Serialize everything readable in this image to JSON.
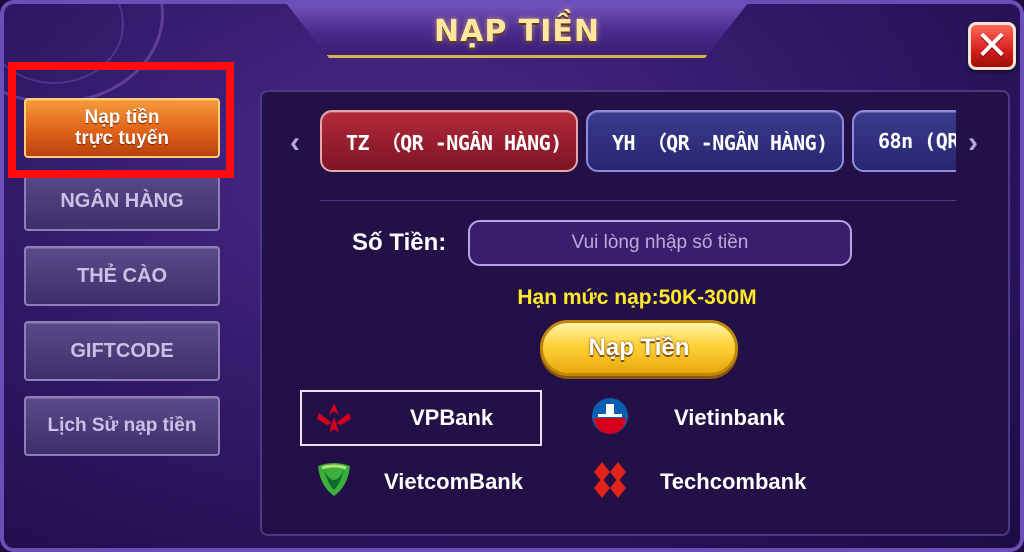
{
  "title": "NẠP TIỀN",
  "close_label": "✕",
  "sidebar": {
    "items": [
      {
        "label_line1": "Nạp tiền",
        "label_line2": "trực tuyến",
        "active": true
      },
      {
        "label": "NGÂN HÀNG"
      },
      {
        "label": "THẺ CÀO"
      },
      {
        "label": "GIFTCODE"
      },
      {
        "label": "Lịch Sử nạp tiền"
      }
    ]
  },
  "tabs": [
    {
      "label": "TZ （QR -NGÂN HÀNG)",
      "active": true
    },
    {
      "label": "YH （QR -NGÂN HÀNG)",
      "active": false
    },
    {
      "label": "68n (QR",
      "active": false
    }
  ],
  "arrows": {
    "left": "‹",
    "right": "›"
  },
  "form": {
    "amount_label": "Số Tiền:",
    "amount_placeholder": "Vui lòng nhập số tiền",
    "amount_value": "",
    "limit_text": "Hạn mức nạp:50K-300M",
    "submit_label": "Nạp Tiền"
  },
  "banks": [
    {
      "name": "VPBank",
      "selected": true,
      "logo": "vpbank-logo",
      "color": "#d6001c"
    },
    {
      "name": "Vietinbank",
      "selected": false,
      "logo": "vietinbank-logo",
      "color": "#0b5fb0"
    },
    {
      "name": "VietcomBank",
      "selected": false,
      "logo": "vietcombank-logo",
      "color": "#3cae3a"
    },
    {
      "name": "Techcombank",
      "selected": false,
      "logo": "techcombank-logo",
      "color": "#e2231a"
    }
  ],
  "colors": {
    "accent": "#ffea2a",
    "active_tab": "#b22a3a",
    "inactive_tab": "#3b3b8e",
    "highlight": "#ff0b0b"
  }
}
